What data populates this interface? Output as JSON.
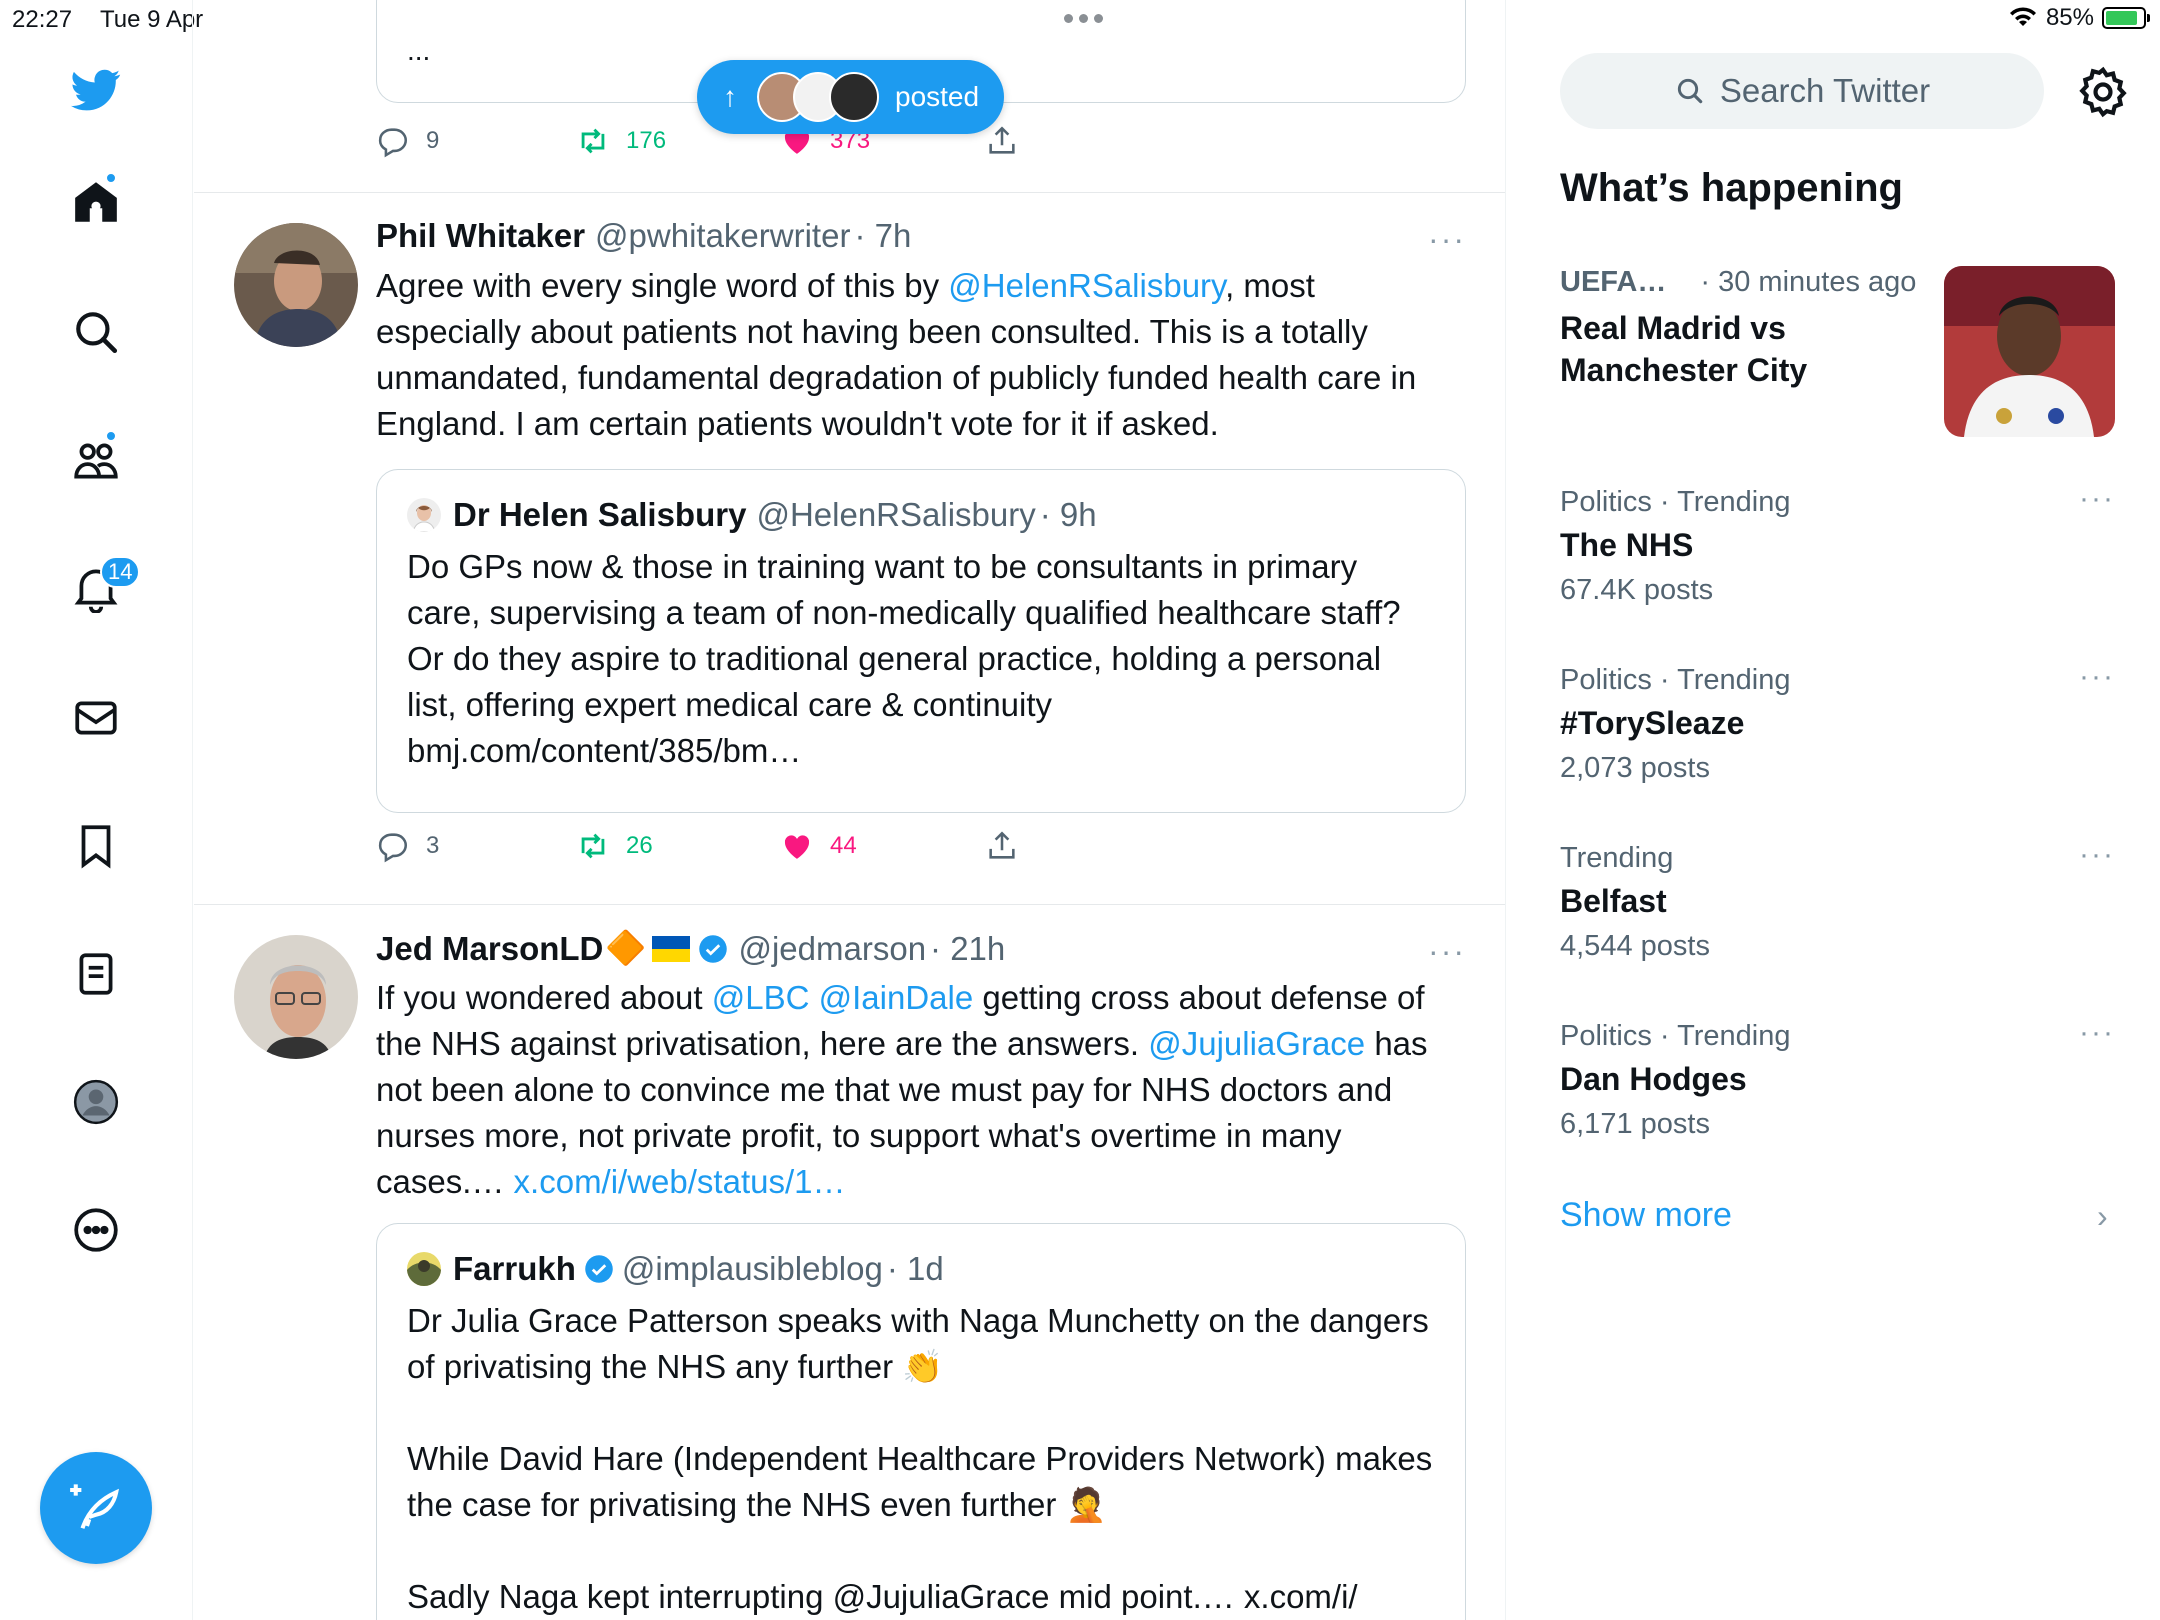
{
  "status_bar": {
    "time": "22:27",
    "date": "Tue 9 Apr",
    "battery": "85%",
    "battery_level": 0.85
  },
  "nav": {
    "notifications_badge": "14",
    "items": [
      "home-icon",
      "search-icon",
      "communities-icon",
      "notifications-icon",
      "messages-icon",
      "bookmarks-icon",
      "lists-icon",
      "profile-icon",
      "more-icon"
    ]
  },
  "new_posts_pill": {
    "label": "posted"
  },
  "top_actions": {
    "replies": "9",
    "retweets": "176",
    "likes": "373",
    "ellipsis": "..."
  },
  "tweets": [
    {
      "name": "Phil Whitaker",
      "handle": "@pwhitakerwriter",
      "time": "· 7h",
      "text_parts": [
        "Agree with every single word of this by ",
        "@HelenRSalisbury",
        ", most especially about patients not having been consulted. This is a totally unmandated, fundamental degradation of publicly funded health care in England. I am certain patients wouldn't vote for it if asked."
      ],
      "quote": {
        "name": "Dr Helen Salisbury",
        "handle": "@HelenRSalisbury",
        "time": "· 9h",
        "text": "Do GPs now & those in training want to be consultants in  primary care, supervising a team of non-medically qualified healthcare staff? Or do they aspire to traditional general practice, holding a personal list, offering expert medical care & continuity bmj.com/content/385/bm…"
      },
      "replies": "3",
      "retweets": "26",
      "likes": "44"
    },
    {
      "name": "Jed MarsonLD",
      "name_emoji": "🔶",
      "handle": "@jedmarson",
      "time": "· 21h",
      "text_parts": [
        "If you wondered about ",
        "@LBC",
        " ",
        "@IainDale",
        " getting cross about defense of the NHS against privatisation, here are the answers. ",
        "@JujuliaGrace",
        " has not been alone to convince me that we must pay for NHS doctors and nurses more, not private profit, to support what's overtime in many cases.… ",
        "x.com/i/web/status/1…"
      ],
      "quote": {
        "name": "Farrukh",
        "handle": "@implausibleblog",
        "time": "· 1d",
        "paragraphs": [
          "Dr Julia Grace Patterson speaks with Naga Munchetty on the dangers of privatising the NHS any further 👏",
          "While David Hare (Independent Healthcare Providers Network) makes the case for privatising the NHS even further 🤦",
          "Sadly Naga kept interrupting @JujuliaGrace mid point.… x.com/i/"
        ]
      }
    }
  ],
  "sidebar": {
    "search_placeholder": "Search Twitter",
    "title": "What’s happening",
    "featured": {
      "category": "UEFA…",
      "time": "· 30 minutes ago",
      "headline": "Real Madrid vs Manchester City"
    },
    "trends": [
      {
        "category": "Politics · Trending",
        "name": "The NHS",
        "count": "67.4K posts"
      },
      {
        "category": "Politics · Trending",
        "name": "#ToryS leaze",
        "count": "2,073 posts"
      },
      {
        "category": "Trending",
        "name": "Belfast",
        "count": "4,544 posts"
      },
      {
        "category": "Politics · Trending",
        "name": "Dan Hodges",
        "count": "6,171 posts"
      }
    ],
    "show_more": "Show more"
  },
  "colors": {
    "accent": "#1d9bf0",
    "like": "#f91880",
    "retweet": "#00ba7c",
    "text": "#0f1419",
    "secondary": "#536471"
  }
}
